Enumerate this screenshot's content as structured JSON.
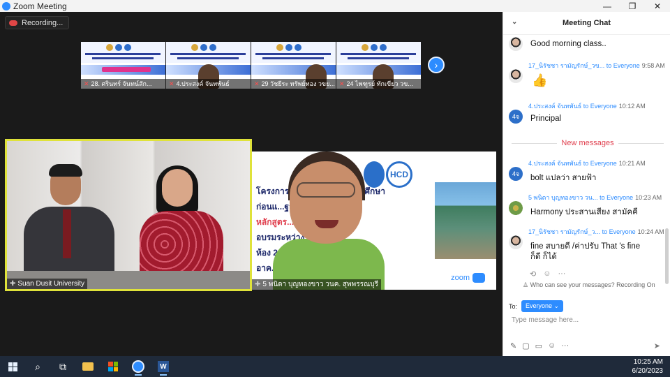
{
  "window": {
    "title": "Zoom Meeting",
    "minimize": "—",
    "restore": "❐",
    "close": "✕"
  },
  "recording": {
    "label": "Recording..."
  },
  "thumbnails": [
    {
      "name": "28. ศรินทร์ จันทน์สัก..."
    },
    {
      "name": "4.ประสงค์ จันทพันธ์"
    },
    {
      "name": "29 วัชยีระ ทรัพย์ทอง วขย..."
    },
    {
      "name": "24 ไพฑูรย์ ทักเขียว วข..."
    }
  ],
  "next_arrow": "›",
  "main_tile": {
    "label": "Suan Dusit University"
  },
  "share_tile": {
    "label": "5 พนิดา บุญทองขาว วนค. สุพพรรณบุรี",
    "slide_lines": [
      "โครงการ...ละบุคลากรทางการศึกษา",
      "ก่อนแ...ฐานะ",
      "หลักสูตร...ะ 130",
      "อบรมระหว่าง... 2566",
      "ห้อง 20...line",
      "อาค..."
    ],
    "hcd": "HCD",
    "zoom_mark": "zoom"
  },
  "chat": {
    "title": "Meeting Chat",
    "collapse": "⌄",
    "messages": [
      {
        "sender": "",
        "to": "",
        "time": "",
        "text": "Good morning class.."
      },
      {
        "sender": "17_นิรัชชา รามัญรักษ์_วข...",
        "to": "to Everyone",
        "time": "9:58 AM",
        "text": "👍"
      },
      {
        "sender": "4.ประสงค์ จันทพันธ์",
        "to": "to Everyone",
        "time": "10:12 AM",
        "text": "Principal",
        "initials": "4จ"
      },
      {
        "sender": "4.ประสงค์ จันทพันธ์",
        "to": "to Everyone",
        "time": "10:21 AM",
        "text": "bolt แปลว่า สายฟ้า",
        "initials": "4จ"
      },
      {
        "sender": "5 พนิดา บุญทองขาว วน...",
        "to": "to Everyone",
        "time": "10:23 AM",
        "text": "Harmony ประสานเสียง สามัคคี"
      },
      {
        "sender": "17_นิรัชชา รามัญรักษ์_ว...",
        "to": "to Everyone",
        "time": "10:24 AM",
        "text": "fine สบายดี  /ค่าปรับ That 's fine",
        "text2": "ก็ดี ก็ได้"
      }
    ],
    "new_messages": "New messages",
    "privacy": "Who can see your messages? Recording On",
    "to_label": "To:",
    "to_value": "Everyone ⌄",
    "placeholder": "Type message here..."
  },
  "taskbar": {
    "time": "10:25 AM",
    "date": "6/20/2023",
    "word": "W"
  }
}
